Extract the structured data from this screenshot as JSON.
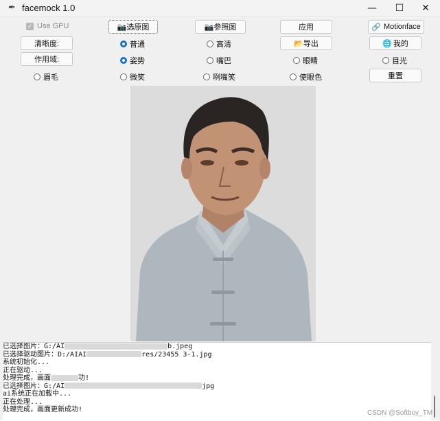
{
  "window": {
    "title": "facemock 1.0",
    "min_glyph": "—",
    "max_glyph": "☐",
    "close_glyph": "✕",
    "app_icon": "feather-icon"
  },
  "toolbar": {
    "use_gpu": "Use GPU",
    "select_image": "选原图",
    "reference_image": "参照图",
    "apply": "应用",
    "motionface": "Motionface",
    "clarity": "清晰度:",
    "export": "导出",
    "mine": "我的",
    "scope": "作用域:",
    "reset": "重置"
  },
  "radios": {
    "normal": "普通",
    "hd": "高清",
    "pose": "姿势",
    "mouth": "嘴巴",
    "eyes": "眼睛",
    "gaze": "目光",
    "eyebrow": "眉毛",
    "smile": "微笑",
    "grin": "咧嘴笑",
    "eye_color": "使眼色"
  },
  "log": {
    "l1a": "已选择图片：G:/AI",
    "l1b": "",
    "l1c": "b.jpeg",
    "l2a": "已选择驱动图片：D:/AIAI",
    "l2b": "res/23455 3-1.jpg",
    "l3": "系统初始化...",
    "l4": "正在驱动...",
    "l5a": "处理完成，画面",
    "l5b": "功!",
    "l6a": "已选择图片：G:/AI",
    "l6b": "jpg",
    "l7": "ai系统正在加载中...",
    "l8": "正在处理...",
    "l9": "处理完成，画面更新成功!"
  },
  "watermark": "CSDN @Softboy_TM"
}
